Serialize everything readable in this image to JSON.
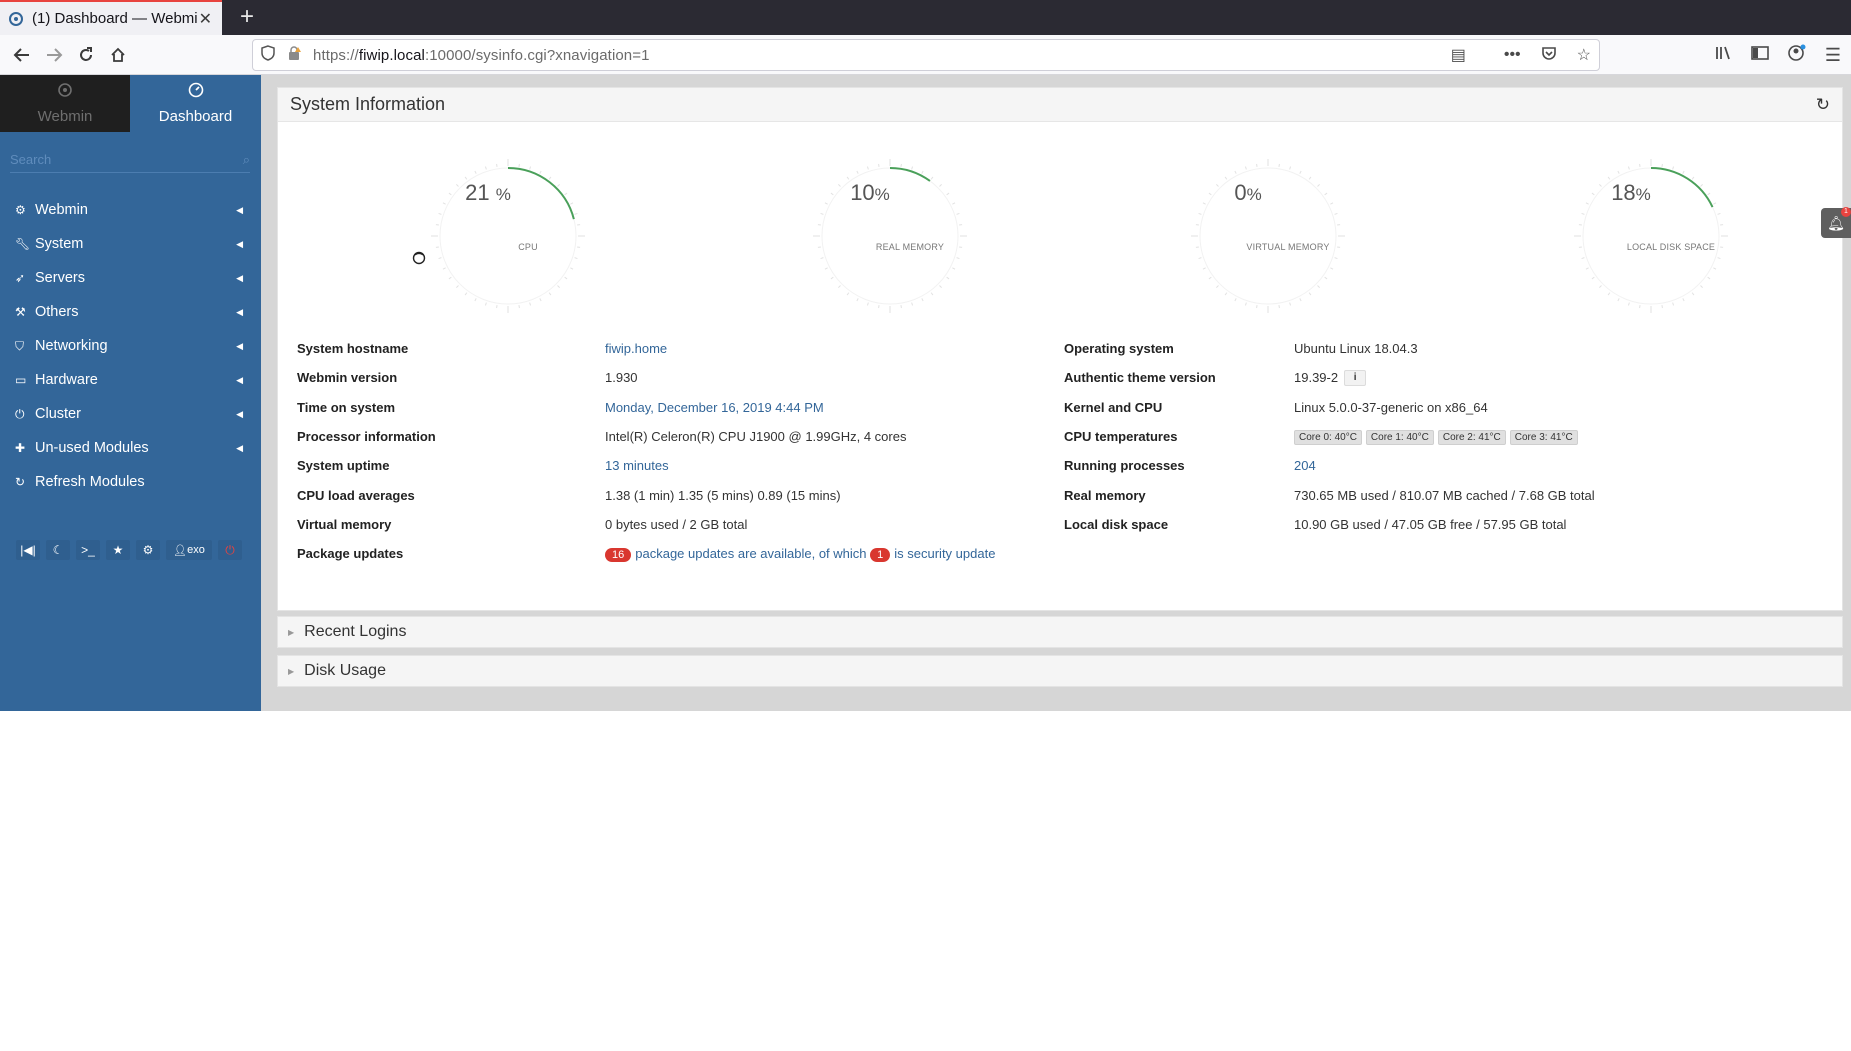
{
  "browser": {
    "tab_title": "(1) Dashboard — Webmin",
    "new_tab": "+",
    "url_prefix": "https://",
    "url_host": "fiwip.local",
    "url_path": ":10000/sysinfo.cgi?xnavigation=1"
  },
  "sidebar": {
    "tabs": [
      {
        "label": "Webmin",
        "icon": "webmin-logo-icon"
      },
      {
        "label": "Dashboard",
        "icon": "dashboard-icon"
      }
    ],
    "search_placeholder": "Search",
    "items": [
      {
        "label": "Webmin",
        "icon": "gear-icon"
      },
      {
        "label": "System",
        "icon": "wrench-icon"
      },
      {
        "label": "Servers",
        "icon": "rocket-icon"
      },
      {
        "label": "Others",
        "icon": "hammer-icon"
      },
      {
        "label": "Networking",
        "icon": "shield-icon"
      },
      {
        "label": "Hardware",
        "icon": "hdd-icon"
      },
      {
        "label": "Cluster",
        "icon": "power-icon"
      },
      {
        "label": "Un-used Modules",
        "icon": "puzzle-icon"
      },
      {
        "label": "Refresh Modules",
        "icon": "refresh-icon"
      }
    ],
    "footer": {
      "user": "exo"
    }
  },
  "panel": {
    "title": "System Information"
  },
  "gauges": [
    {
      "value": "21",
      "unit": "%",
      "label": "CPU",
      "percent": 21
    },
    {
      "value": "10",
      "unit": "%",
      "label": "REAL MEMORY",
      "percent": 10
    },
    {
      "value": "0",
      "unit": "%",
      "label": "VIRTUAL MEMORY",
      "percent": 0
    },
    {
      "value": "18",
      "unit": "%",
      "label": "LOCAL DISK SPACE",
      "percent": 18
    }
  ],
  "info_left": [
    {
      "label": "System hostname",
      "value": "fiwip.home"
    },
    {
      "label": "Webmin version",
      "value": "1.930"
    },
    {
      "label": "Time on system",
      "value": "Monday, December 16, 2019 4:44 PM"
    },
    {
      "label": "Processor information",
      "value": "Intel(R) Celeron(R) CPU J1900 @ 1.99GHz, 4 cores"
    },
    {
      "label": "System uptime",
      "value": "13 minutes"
    },
    {
      "label": "CPU load averages",
      "value": "1.38 (1 min) 1.35 (5 mins) 0.89 (15 mins)"
    },
    {
      "label": "Virtual memory",
      "value": "0 bytes used / 2 GB total"
    },
    {
      "label": "Package updates",
      "count": "16",
      "text": "package updates are available, of which",
      "security_count": "1",
      "security_text": "is security update"
    }
  ],
  "info_right": [
    {
      "label": "Operating system",
      "value": "Ubuntu Linux 18.04.3"
    },
    {
      "label": "Authentic theme version",
      "value": "19.39-2"
    },
    {
      "label": "Kernel and CPU",
      "value": "Linux 5.0.0-37-generic on x86_64"
    },
    {
      "label": "CPU temperatures",
      "temps": [
        "Core 0: 40°C",
        "Core 1: 40°C",
        "Core 2: 41°C",
        "Core 3: 41°C"
      ]
    },
    {
      "label": "Running processes",
      "value": "204"
    },
    {
      "label": "Real memory",
      "value": "730.65 MB used / 810.07 MB cached / 7.68 GB total"
    },
    {
      "label": "Local disk space",
      "value": "10.90 GB used / 47.05 GB free / 57.95 GB total"
    }
  ],
  "sections": [
    {
      "title": "Recent Logins"
    },
    {
      "title": "Disk Usage"
    }
  ],
  "notifications": {
    "count": "1"
  }
}
